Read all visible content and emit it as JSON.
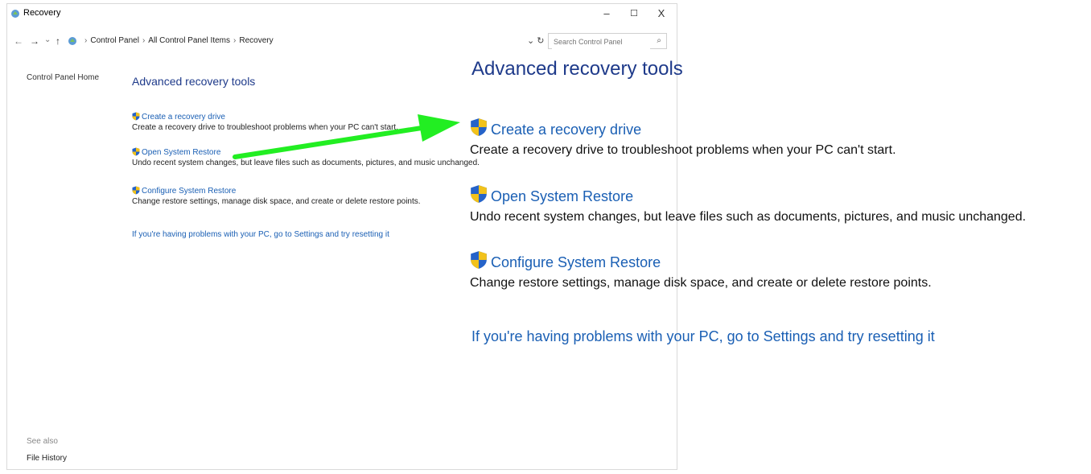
{
  "window": {
    "title": "Recovery",
    "minimize": "–",
    "maximize": "☐",
    "close": "X"
  },
  "address": {
    "back": "←",
    "forward": "→",
    "recent": "⌄",
    "up": "↑",
    "crumbs": [
      "Control Panel",
      "All Control Panel Items",
      "Recovery"
    ],
    "separator": "›",
    "refresh": "⌄ ↻",
    "search_placeholder": "Search Control Panel",
    "search_icon": "⌕"
  },
  "sidebar": {
    "home": "Control Panel Home",
    "see_also": "See also",
    "file_history": "File History"
  },
  "main": {
    "heading": "Advanced recovery tools",
    "items": [
      {
        "label": "Create a recovery drive",
        "desc": "Create a recovery drive to troubleshoot problems when your PC can't start.",
        "icon": "uac-shield-icon"
      },
      {
        "label": "Open System Restore",
        "desc": "Undo recent system changes, but leave files such as documents, pictures, and music unchanged.",
        "icon": "uac-shield-icon"
      },
      {
        "label": "Configure System Restore",
        "desc": "Change restore settings, manage disk space, and create or delete restore points.",
        "icon": "uac-shield-icon"
      }
    ],
    "reset_link": "If you're having problems with your PC, go to Settings and try resetting it"
  },
  "zoom": {
    "heading": "Advanced recovery tools",
    "items": [
      {
        "label": "Create a recovery drive",
        "desc": "Create a recovery drive to troubleshoot problems when your PC can't start."
      },
      {
        "label": "Open System Restore",
        "desc": "Undo recent system changes, but leave files such as documents, pictures, and music unchanged."
      },
      {
        "label": "Configure System Restore",
        "desc": "Change restore settings, manage disk space, and create or delete restore points."
      }
    ],
    "reset_link": "If you're having problems with your PC, go to Settings and try resetting it"
  },
  "colors": {
    "link": "#1a5fb4",
    "heading": "#1e3a8a",
    "annotation_arrow": "#22ee22",
    "shield_blue": "#2563c9",
    "shield_yellow": "#f2c21b"
  }
}
